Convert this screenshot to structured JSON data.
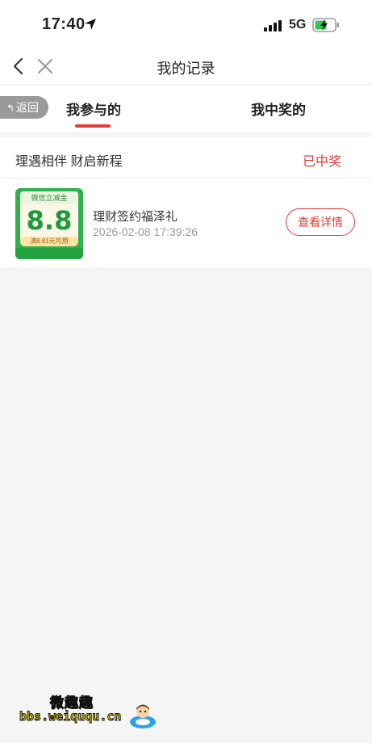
{
  "status_bar": {
    "time": "17:40",
    "network": "5G"
  },
  "nav": {
    "title": "我的记录"
  },
  "tabs": {
    "return_label": "返回",
    "items": [
      {
        "label": "我参与的",
        "active": true
      },
      {
        "label": "我中奖的",
        "active": false
      }
    ]
  },
  "section": {
    "title": "理遇相伴 财启新程",
    "status": "已中奖"
  },
  "record": {
    "thumb": {
      "header": "微信立减金",
      "currency": "¥",
      "amount": "8.8",
      "condition": "满8.81元可用"
    },
    "name": "理财签约福泽礼",
    "time": "2026-02-08 17:39:26",
    "action_label": "查看详情"
  },
  "watermark": {
    "title": "微趣趣",
    "url": "bbs.weiququ.cn"
  },
  "colors": {
    "accent": "#e03c31",
    "background": "#f5f5f5",
    "prize_green": "#2fb24c"
  }
}
